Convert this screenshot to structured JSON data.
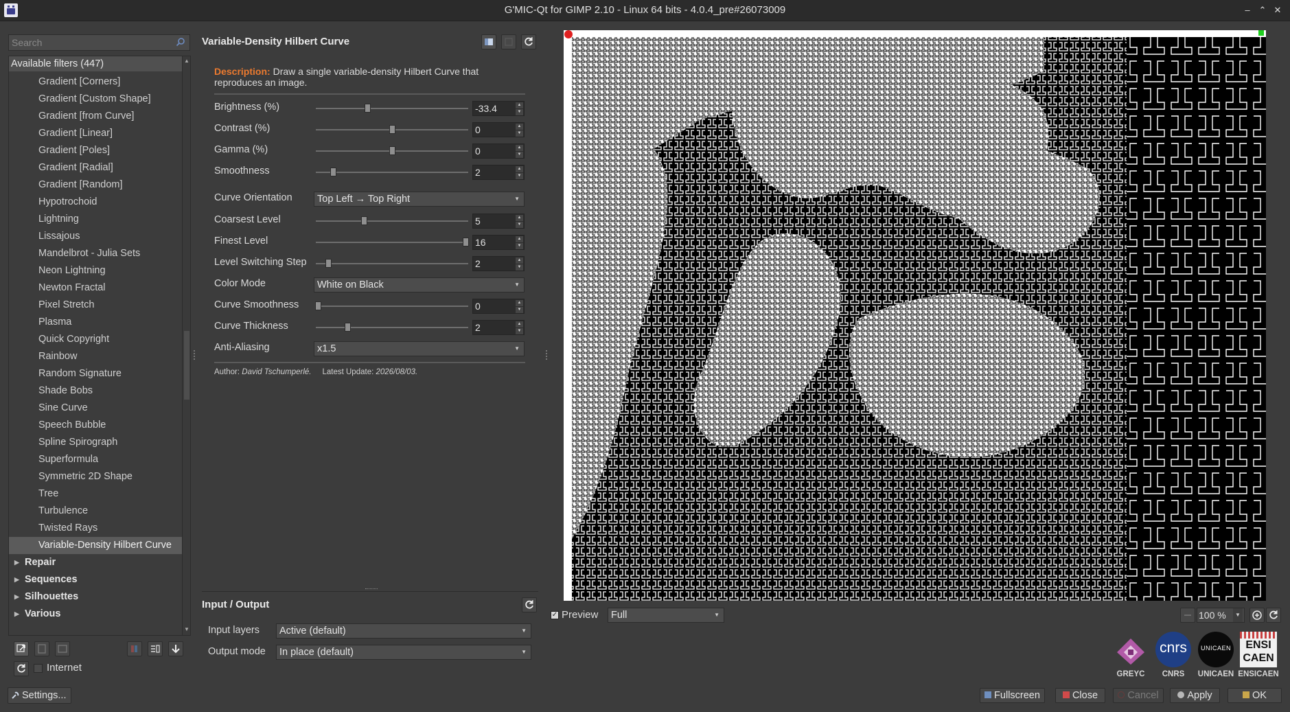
{
  "window": {
    "title": "G'MIC-Qt for GIMP 2.10 - Linux 64 bits - 4.0.4_pre#26073009",
    "buttons": [
      "–",
      "⌃",
      "⤢",
      "✕"
    ]
  },
  "search": {
    "placeholder": "Search"
  },
  "tree": {
    "header": "Available filters (447)",
    "items": [
      "Gradient [Corners]",
      "Gradient [Custom Shape]",
      "Gradient [from Curve]",
      "Gradient [Linear]",
      "Gradient [Poles]",
      "Gradient [Radial]",
      "Gradient [Random]",
      "Hypotrochoid",
      "Lightning",
      "Lissajous",
      "Mandelbrot - Julia Sets",
      "Neon Lightning",
      "Newton Fractal",
      "Pixel Stretch",
      "Plasma",
      "Quick Copyright",
      "Rainbow",
      "Random Signature",
      "Shade Bobs",
      "Sine Curve",
      "Speech Bubble",
      "Spline Spirograph",
      "Superformula",
      "Symmetric 2D Shape",
      "Tree",
      "Turbulence",
      "Twisted Rays",
      "Variable-Density Hilbert Curve"
    ],
    "selected": "Variable-Density Hilbert Curve",
    "categories": [
      "Repair",
      "Sequences",
      "Silhouettes",
      "Various"
    ]
  },
  "internet": {
    "label": "Internet"
  },
  "settings": {
    "label": "Settings..."
  },
  "filter": {
    "title": "Variable-Density Hilbert Curve",
    "description_label": "Description:",
    "description_text": "Draw a single variable-density Hilbert Curve that reproduces an image.",
    "params": [
      {
        "label": "Brightness (%)",
        "type": "slider",
        "value": "-33.4",
        "fraction": 0.333
      },
      {
        "label": "Contrast (%)",
        "type": "slider",
        "value": "0",
        "fraction": 0.5
      },
      {
        "label": "Gamma (%)",
        "type": "slider",
        "value": "0",
        "fraction": 0.5
      },
      {
        "label": "Smoothness",
        "type": "slider",
        "value": "2",
        "fraction": 0.1
      },
      {
        "label": "Curve Orientation",
        "type": "combo",
        "value": "Top Left → Top Right"
      },
      {
        "label": "Coarsest Level",
        "type": "slider",
        "value": "5",
        "fraction": 0.31
      },
      {
        "label": "Finest Level",
        "type": "slider",
        "value": "16",
        "fraction": 1.0
      },
      {
        "label": "Level Switching Step",
        "type": "slider",
        "value": "2",
        "fraction": 0.07
      },
      {
        "label": "Color Mode",
        "type": "combo",
        "value": "White on Black"
      },
      {
        "label": "Curve Smoothness",
        "type": "slider",
        "value": "0",
        "fraction": 0.0
      },
      {
        "label": "Curve Thickness",
        "type": "slider",
        "value": "2",
        "fraction": 0.2
      },
      {
        "label": "Anti-Aliasing",
        "type": "combo",
        "value": "x1.5"
      }
    ],
    "author_label": "Author:",
    "author": "David Tschumperlé.",
    "update_label": "Latest Update:",
    "update": "2026/08/03."
  },
  "io": {
    "title": "Input / Output",
    "input_label": "Input layers",
    "input_value": "Active (default)",
    "output_label": "Output mode",
    "output_value": "In place (default)"
  },
  "preview": {
    "label": "Preview",
    "checked": true,
    "mode": "Full",
    "zoom": "100 %"
  },
  "logos": [
    "GREYC",
    "CNRS",
    "UNICAEN",
    "ENSICAEN"
  ],
  "logo_texts": {
    "cnrs": "cnrs",
    "unicaen": "UNICAEN",
    "ensicaen": "ENSI\nCAEN"
  },
  "buttons": {
    "fullscreen": "Fullscreen",
    "close": "Close",
    "cancel": "Cancel",
    "apply": "Apply",
    "ok": "OK"
  },
  "colors": {
    "accent": "#ec7a2f",
    "background": "#3c3c3c"
  }
}
